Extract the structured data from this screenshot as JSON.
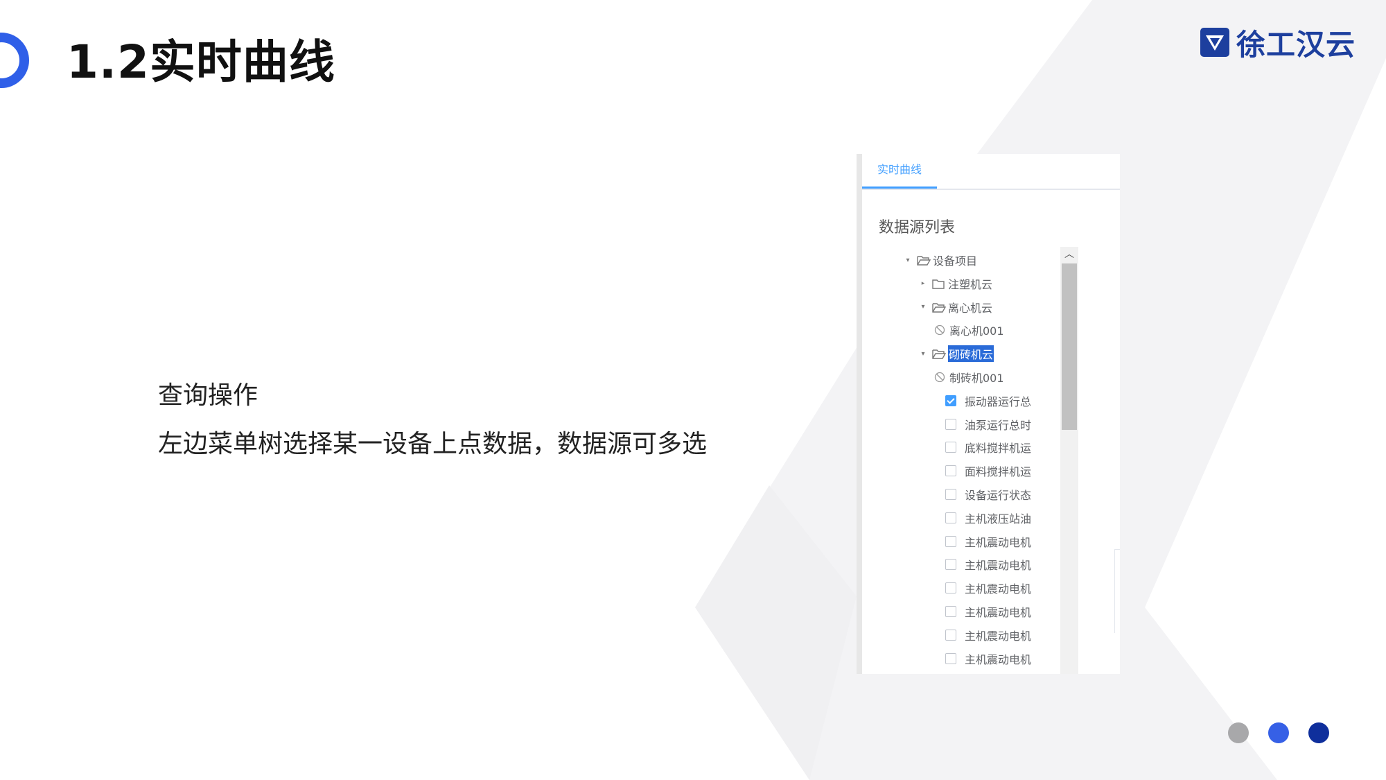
{
  "slide": {
    "title": "1.2实时曲线",
    "logo_text": "徐工汉云",
    "body_lines": [
      "查询操作",
      "左边菜单树选择某一设备上点数据，数据源可多选"
    ],
    "colors": {
      "accent_blue": "#2f5fe8",
      "logo_blue": "#1d3f9e",
      "background_shape": "#f3f3f5",
      "dots": [
        "#a8a8aa",
        "#3660e6",
        "#0f2f9c"
      ]
    },
    "logo_icon": "xcmg-shield-logo-icon"
  },
  "panel": {
    "tab_label": "实时曲线",
    "section_title": "数据源列表",
    "tree": [
      {
        "label": "设备项目",
        "level": 0,
        "kind": "folder",
        "expanded": true
      },
      {
        "label": "注塑机云",
        "level": 1,
        "kind": "folder",
        "expanded": false
      },
      {
        "label": "离心机云",
        "level": 1,
        "kind": "folder",
        "expanded": true
      },
      {
        "label": "离心机001",
        "level": 2,
        "kind": "device"
      },
      {
        "label": "砌砖机云",
        "level": 1,
        "kind": "folder",
        "expanded": true,
        "highlighted": true
      },
      {
        "label": "制砖机001",
        "level": 2,
        "kind": "device"
      },
      {
        "label": "振动器运行总",
        "level": 3,
        "kind": "point",
        "checked": true
      },
      {
        "label": "油泵运行总时",
        "level": 3,
        "kind": "point",
        "checked": false
      },
      {
        "label": "底料搅拌机运",
        "level": 3,
        "kind": "point",
        "checked": false
      },
      {
        "label": "面料搅拌机运",
        "level": 3,
        "kind": "point",
        "checked": false
      },
      {
        "label": "设备运行状态",
        "level": 3,
        "kind": "point",
        "checked": false
      },
      {
        "label": "主机液压站油",
        "level": 3,
        "kind": "point",
        "checked": false
      },
      {
        "label": "主机震动电机",
        "level": 3,
        "kind": "point",
        "checked": false
      },
      {
        "label": "主机震动电机",
        "level": 3,
        "kind": "point",
        "checked": false
      },
      {
        "label": "主机震动电机",
        "level": 3,
        "kind": "point",
        "checked": false
      },
      {
        "label": "主机震动电机",
        "level": 3,
        "kind": "point",
        "checked": false
      },
      {
        "label": "主机震动电机",
        "level": 3,
        "kind": "point",
        "checked": false
      },
      {
        "label": "主机震动电机",
        "level": 3,
        "kind": "point",
        "checked": false
      }
    ]
  }
}
